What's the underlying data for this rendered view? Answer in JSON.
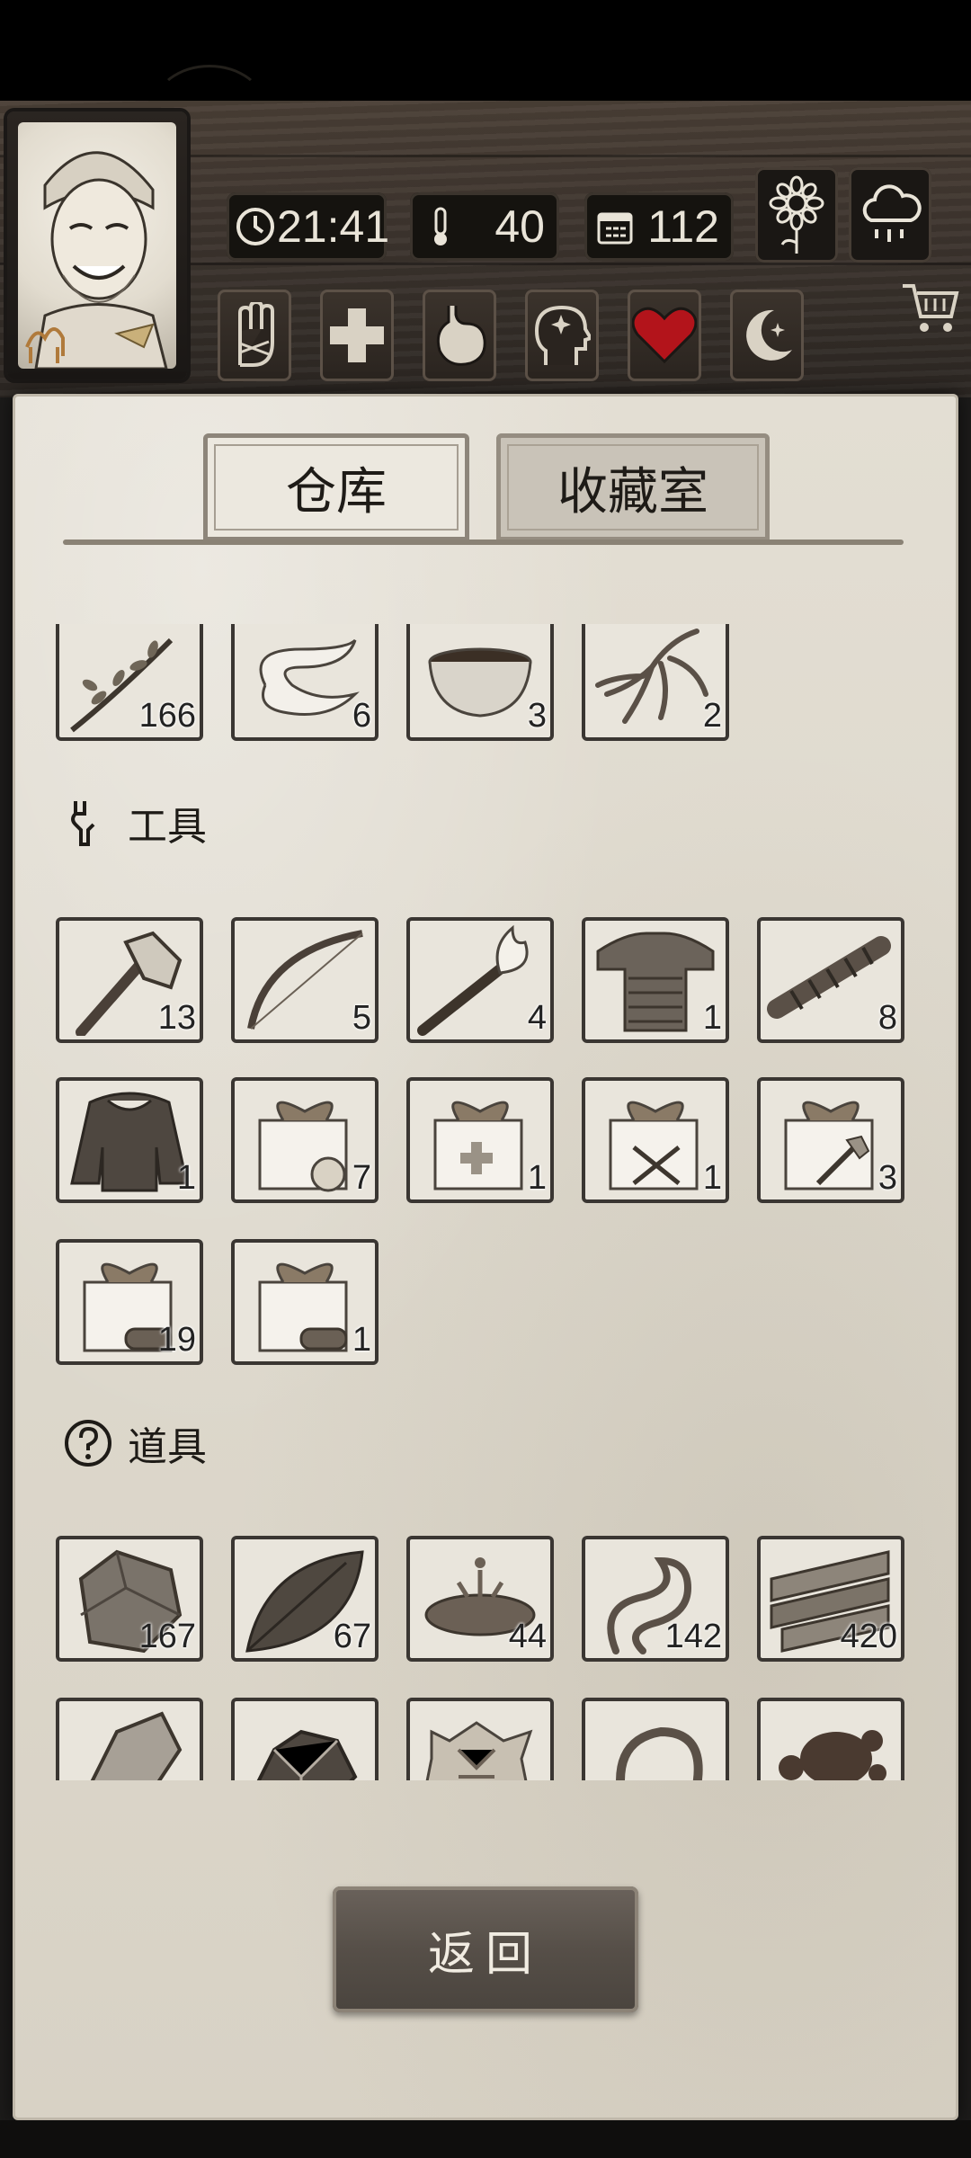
{
  "hud": {
    "time": "21:41",
    "temperature": "40",
    "days": "112",
    "icons": [
      "clock-icon",
      "thermometer-icon",
      "calendar-icon"
    ],
    "weather_buttons": [
      "sunflower-icon",
      "rain-cloud-icon"
    ],
    "skill_buttons": [
      "hand-icon",
      "health-cross-icon",
      "stomach-icon",
      "mind-icon",
      "heart-icon",
      "moon-icon"
    ],
    "heart_color": "#b3141b"
  },
  "tabs": {
    "warehouse": "仓库",
    "collection": "收藏室"
  },
  "top_row": [
    {
      "icon": "herb-branch-icon",
      "count": "166"
    },
    {
      "icon": "bandage-icon",
      "count": "6"
    },
    {
      "icon": "bowl-icon",
      "count": "3"
    },
    {
      "icon": "ginseng-root-icon",
      "count": "2"
    }
  ],
  "sections": {
    "tools": {
      "title": "工具",
      "items": [
        {
          "icon": "stone-axe-icon",
          "count": "13"
        },
        {
          "icon": "bow-icon",
          "count": "5"
        },
        {
          "icon": "torch-icon",
          "count": "4"
        },
        {
          "icon": "armor-vest-icon",
          "count": "1"
        },
        {
          "icon": "rope-bundle-icon",
          "count": "8"
        },
        {
          "icon": "fur-coat-icon",
          "count": "1"
        },
        {
          "icon": "food-gift-box-icon",
          "count": "7"
        },
        {
          "icon": "medical-gift-box-icon",
          "count": "1"
        },
        {
          "icon": "weapon-gift-box-icon",
          "count": "1"
        },
        {
          "icon": "tool-gift-box-icon",
          "count": "3"
        },
        {
          "icon": "wood-gift-box-icon",
          "count": "19"
        },
        {
          "icon": "wood-gift-box-icon",
          "count": "1"
        }
      ]
    },
    "props": {
      "title": "道具",
      "items": [
        {
          "icon": "stone-icon",
          "count": "167"
        },
        {
          "icon": "leaf-icon",
          "count": "67"
        },
        {
          "icon": "water-puddle-icon",
          "count": "44"
        },
        {
          "icon": "vine-icon",
          "count": "142"
        },
        {
          "icon": "wood-planks-icon",
          "count": "420"
        },
        {
          "icon": "flint-icon",
          "count": ""
        },
        {
          "icon": "ore-icon",
          "count": ""
        },
        {
          "icon": "animal-hide-icon",
          "count": ""
        },
        {
          "icon": "rope-icon",
          "count": ""
        },
        {
          "icon": "resin-icon",
          "count": ""
        }
      ]
    }
  },
  "back_button": "返回"
}
